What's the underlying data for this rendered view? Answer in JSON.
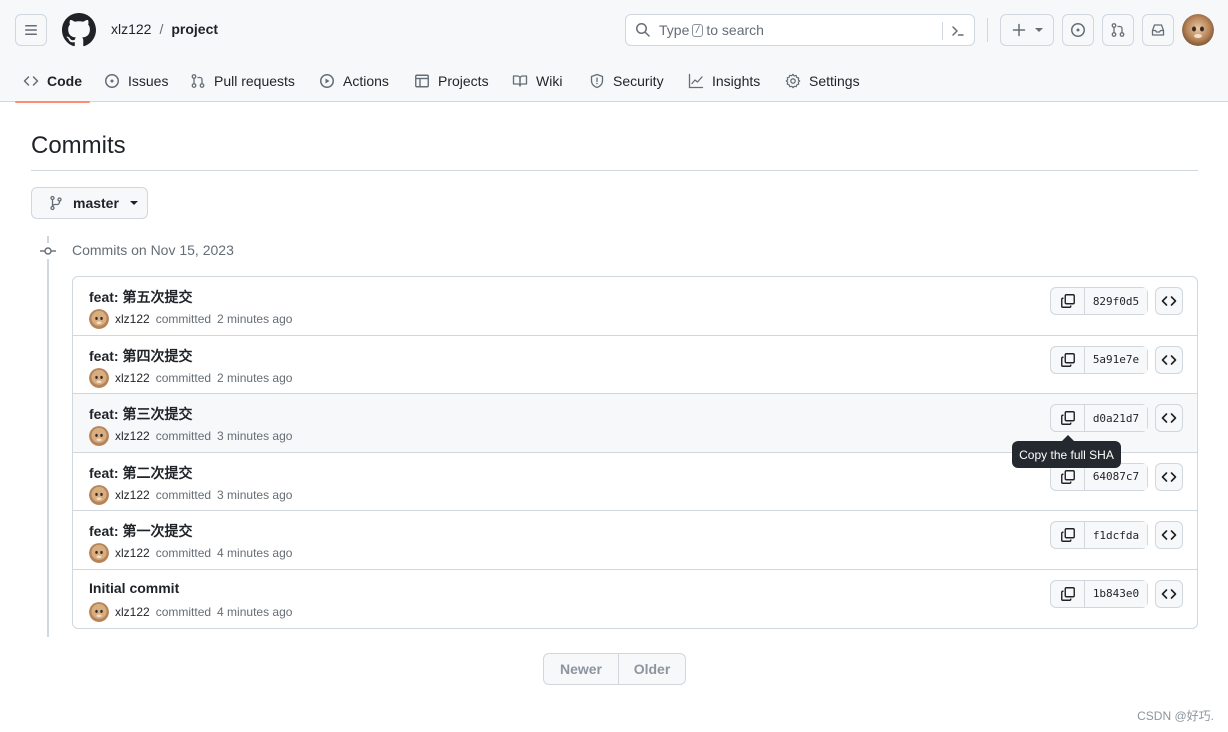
{
  "header": {
    "owner": "xlz122",
    "separator": "/",
    "repo": "project",
    "search_type": "Type",
    "search_key": "/",
    "search_rest": "to search"
  },
  "tabs": [
    {
      "label": "Code",
      "icon": "code-icon",
      "active": true
    },
    {
      "label": "Issues",
      "icon": "issue-icon"
    },
    {
      "label": "Pull requests",
      "icon": "pull-request-icon"
    },
    {
      "label": "Actions",
      "icon": "play-icon"
    },
    {
      "label": "Projects",
      "icon": "table-icon"
    },
    {
      "label": "Wiki",
      "icon": "book-icon"
    },
    {
      "label": "Security",
      "icon": "shield-icon"
    },
    {
      "label": "Insights",
      "icon": "graph-icon"
    },
    {
      "label": "Settings",
      "icon": "gear-icon"
    }
  ],
  "main": {
    "title": "Commits",
    "branch": "master",
    "date_heading": "Commits on Nov 15, 2023"
  },
  "commits": [
    {
      "message": "feat: 第五次提交",
      "author": "xlz122",
      "action": "committed",
      "time": "2 minutes ago",
      "sha": "829f0d5"
    },
    {
      "message": "feat: 第四次提交",
      "author": "xlz122",
      "action": "committed",
      "time": "2 minutes ago",
      "sha": "5a91e7e"
    },
    {
      "message": "feat: 第三次提交",
      "author": "xlz122",
      "action": "committed",
      "time": "3 minutes ago",
      "sha": "d0a21d7",
      "hovered": true
    },
    {
      "message": "feat: 第二次提交",
      "author": "xlz122",
      "action": "committed",
      "time": "3 minutes ago",
      "sha": "64087c7"
    },
    {
      "message": "feat: 第一次提交",
      "author": "xlz122",
      "action": "committed",
      "time": "4 minutes ago",
      "sha": "f1dcfda"
    },
    {
      "message": "Initial commit",
      "author": "xlz122",
      "action": "committed",
      "time": "4 minutes ago",
      "sha": "1b843e0"
    }
  ],
  "tooltip": "Copy the full SHA",
  "pagination": {
    "newer": "Newer",
    "older": "Older"
  },
  "watermark": "CSDN @好巧.",
  "colors": {
    "accent_underline": "#fd8c73",
    "tooltip_bg": "#24292f",
    "border": "#d0d7de"
  }
}
